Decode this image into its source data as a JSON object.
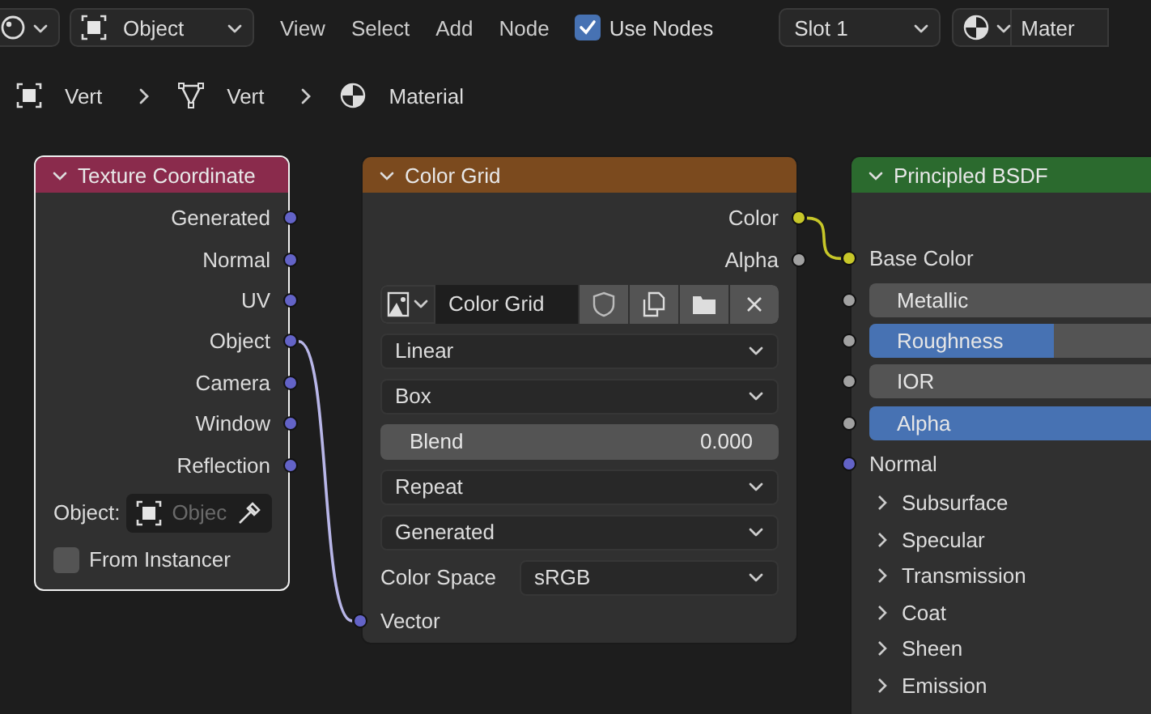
{
  "toolbar": {
    "mode": "Object",
    "menus": [
      "View",
      "Select",
      "Add",
      "Node"
    ],
    "use_nodes": {
      "label": "Use Nodes",
      "checked": true
    },
    "slot": "Slot 1",
    "material": "Mater"
  },
  "breadcrumbs": [
    {
      "kind": "object",
      "label": "Vert"
    },
    {
      "kind": "mesh",
      "label": "Vert"
    },
    {
      "kind": "material",
      "label": "Material"
    }
  ],
  "nodes": [
    {
      "title": "Texture Coordinate",
      "color": "#8a2b4c",
      "selected": true,
      "rows": [
        {
          "kind": "output",
          "label": "Generated",
          "color": "#6363c7"
        },
        {
          "kind": "output",
          "label": "Normal",
          "color": "#6363c7"
        },
        {
          "kind": "output",
          "label": "UV",
          "color": "#6363c7"
        },
        {
          "kind": "output",
          "label": "Object",
          "color": "#6363c7"
        },
        {
          "kind": "output",
          "label": "Camera",
          "color": "#6363c7"
        },
        {
          "kind": "output",
          "label": "Window",
          "color": "#6363c7"
        },
        {
          "kind": "output",
          "label": "Reflection",
          "color": "#6363c7"
        },
        {
          "kind": "object_field",
          "label": "Object:",
          "placeholder": "Objec"
        },
        {
          "kind": "checkbox",
          "label": "From Instancer",
          "checked": false
        }
      ]
    },
    {
      "title": "Color Grid",
      "color": "#7b4a1e",
      "selected": false,
      "rows": [
        {
          "kind": "output",
          "label": "Color",
          "color": "#c7c729"
        },
        {
          "kind": "output",
          "label": "Alpha",
          "color": "#a1a1a1"
        },
        {
          "kind": "image",
          "value": "Color Grid"
        },
        {
          "kind": "dropdown",
          "value": "Linear"
        },
        {
          "kind": "dropdown",
          "value": "Box"
        },
        {
          "kind": "number",
          "label": "Blend",
          "value": "0.000"
        },
        {
          "kind": "dropdown",
          "value": "Repeat"
        },
        {
          "kind": "dropdown",
          "value": "Generated"
        },
        {
          "kind": "labeled_dropdown",
          "label": "Color Space",
          "value": "sRGB"
        },
        {
          "kind": "input",
          "label": "Vector",
          "color": "#6363c7"
        }
      ]
    },
    {
      "title": "Principled BSDF",
      "color": "#2b6a2e",
      "selected": false,
      "rows": [
        {
          "kind": "input",
          "label": "Base Color",
          "color": "#c7c729"
        },
        {
          "kind": "slider",
          "label": "Metallic",
          "level": 0,
          "color": "#a1a1a1"
        },
        {
          "kind": "slider",
          "label": "Roughness",
          "level": 0.5,
          "color": "#a1a1a1"
        },
        {
          "kind": "slider",
          "label": "IOR",
          "level": 0,
          "color": "#a1a1a1"
        },
        {
          "kind": "slider",
          "label": "Alpha",
          "level": 1,
          "color": "#a1a1a1"
        },
        {
          "kind": "input",
          "label": "Normal",
          "color": "#6363c7"
        },
        {
          "kind": "panel",
          "label": "Subsurface",
          "expanded": false
        },
        {
          "kind": "panel",
          "label": "Specular",
          "expanded": false
        },
        {
          "kind": "panel",
          "label": "Transmission",
          "expanded": false
        },
        {
          "kind": "panel",
          "label": "Coat",
          "expanded": false
        },
        {
          "kind": "panel",
          "label": "Sheen",
          "expanded": false
        },
        {
          "kind": "panel",
          "label": "Emission",
          "expanded": false
        }
      ]
    }
  ]
}
